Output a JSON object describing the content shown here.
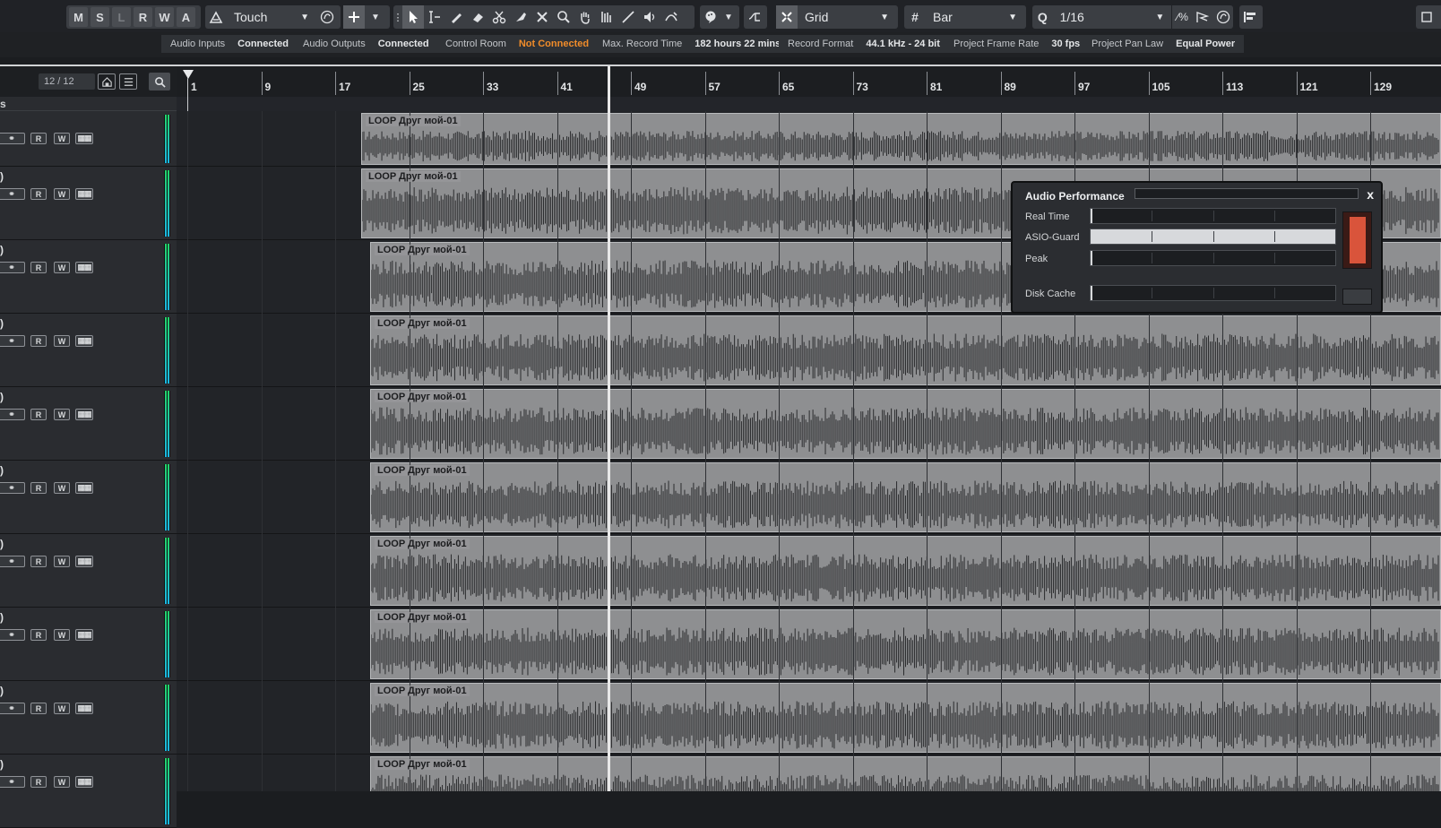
{
  "toolbar": {
    "state_buttons": [
      "M",
      "S",
      "L",
      "R",
      "W",
      "A"
    ],
    "automation_mode": "Touch",
    "snap_type": "Grid",
    "grid_type": "Bar",
    "quantize_value": "1/16",
    "icons": [
      "automation-icon",
      "suspend-icon",
      "object-selection-icon",
      "select-tool-icon",
      "range-tool-icon",
      "draw-tool-icon",
      "erase-tool-icon",
      "split-tool-icon",
      "glue-tool-icon",
      "mute-tool-icon",
      "zoom-tool-icon",
      "hand-tool-icon",
      "comp-tool-icon",
      "line-tool-icon",
      "play-tool-icon",
      "warp-tool-icon",
      "color-tool-icon",
      "snap-zero-icon",
      "snap-toggle-icon",
      "grid-icon",
      "quantize-icon",
      "iterative-quantize-icon",
      "quantize-apply-icon",
      "quantize-reset-icon",
      "window-layout-icon"
    ]
  },
  "status": {
    "audio_inputs_label": "Audio Inputs",
    "audio_inputs_value": "Connected",
    "audio_outputs_label": "Audio Outputs",
    "audio_outputs_value": "Connected",
    "control_room_label": "Control Room",
    "control_room_value": "Not Connected",
    "max_record_label": "Max. Record Time",
    "max_record_value": "182 hours 22 mins",
    "record_format_label": "Record Format",
    "record_format_value": "44.1 kHz - 24 bit",
    "frame_rate_label": "Project Frame Rate",
    "frame_rate_value": "30 fps",
    "pan_law_label": "Project Pan Law",
    "pan_law_value": "Equal Power",
    "warn_color": "#f08c2a"
  },
  "tracklist": {
    "track_count": "12 / 12",
    "subheader": "s",
    "tracks": [
      {
        "name": ""
      },
      {
        "name": ")"
      },
      {
        "name": ")"
      },
      {
        "name": ")"
      },
      {
        "name": ")"
      },
      {
        "name": ")"
      },
      {
        "name": ")"
      },
      {
        "name": ")"
      },
      {
        "name": ")"
      },
      {
        "name": ")"
      }
    ],
    "track_buttons": {
      "read": "R",
      "write": "W"
    }
  },
  "ruler": {
    "bars": [
      "1",
      "9",
      "17",
      "25",
      "33",
      "41",
      "49",
      "57",
      "65",
      "73",
      "81",
      "89",
      "97",
      "105",
      "113",
      "121",
      "129"
    ]
  },
  "events": {
    "name": "LOOP Друг мой-01",
    "color": "#8e8f91"
  },
  "audio_performance": {
    "title": "Audio Performance",
    "close": "x",
    "rows": [
      {
        "label": "Real Time",
        "level": 0.0
      },
      {
        "label": "ASIO-Guard",
        "level": 1.0
      },
      {
        "label": "Peak",
        "level": 0.0
      }
    ],
    "disk_cache_label": "Disk Cache",
    "disk_cache_level": 0.0,
    "overload_color": "#d9543b"
  }
}
